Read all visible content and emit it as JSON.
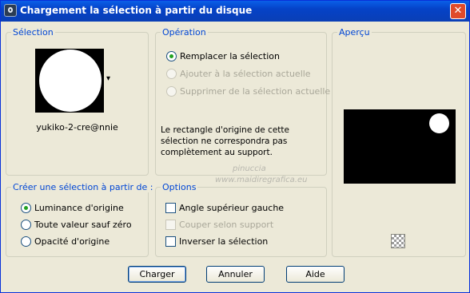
{
  "window": {
    "title": "Chargement la sélection à partir du disque",
    "close_glyph": "✕"
  },
  "selection": {
    "legend": "Sélection",
    "file_name": "yukiko-2-cre@nnie",
    "dropdown_glyph": "▾"
  },
  "operation": {
    "legend": "Opération",
    "options": [
      {
        "label": "Remplacer la sélection",
        "checked": true,
        "enabled": true
      },
      {
        "label": "Ajouter à la sélection actuelle",
        "checked": false,
        "enabled": false
      },
      {
        "label": "Supprimer de la sélection actuelle",
        "checked": false,
        "enabled": false
      }
    ],
    "message": [
      "Le rectangle d'origine de cette",
      "sélection ne correspondra pas",
      "complètement au support."
    ]
  },
  "preview": {
    "legend": "Aperçu"
  },
  "create_from": {
    "legend": "Créer une sélection à partir de :",
    "options": [
      {
        "label": "Luminance d'origine",
        "checked": true
      },
      {
        "label": "Toute valeur sauf zéro",
        "checked": false
      },
      {
        "label": "Opacité d'origine",
        "checked": false
      }
    ]
  },
  "options": {
    "legend": "Options",
    "checkboxes": [
      {
        "label": "Angle supérieur gauche",
        "checked": false,
        "enabled": true
      },
      {
        "label": "Couper selon support",
        "checked": false,
        "enabled": false
      },
      {
        "label": "Inverser la sélection",
        "checked": false,
        "enabled": true
      }
    ]
  },
  "buttons": {
    "load": "Charger",
    "cancel": "Annuler",
    "help": "Aide"
  },
  "watermark": {
    "line1": "pinuccia",
    "line2": "www.maidiregrafica.eu"
  }
}
